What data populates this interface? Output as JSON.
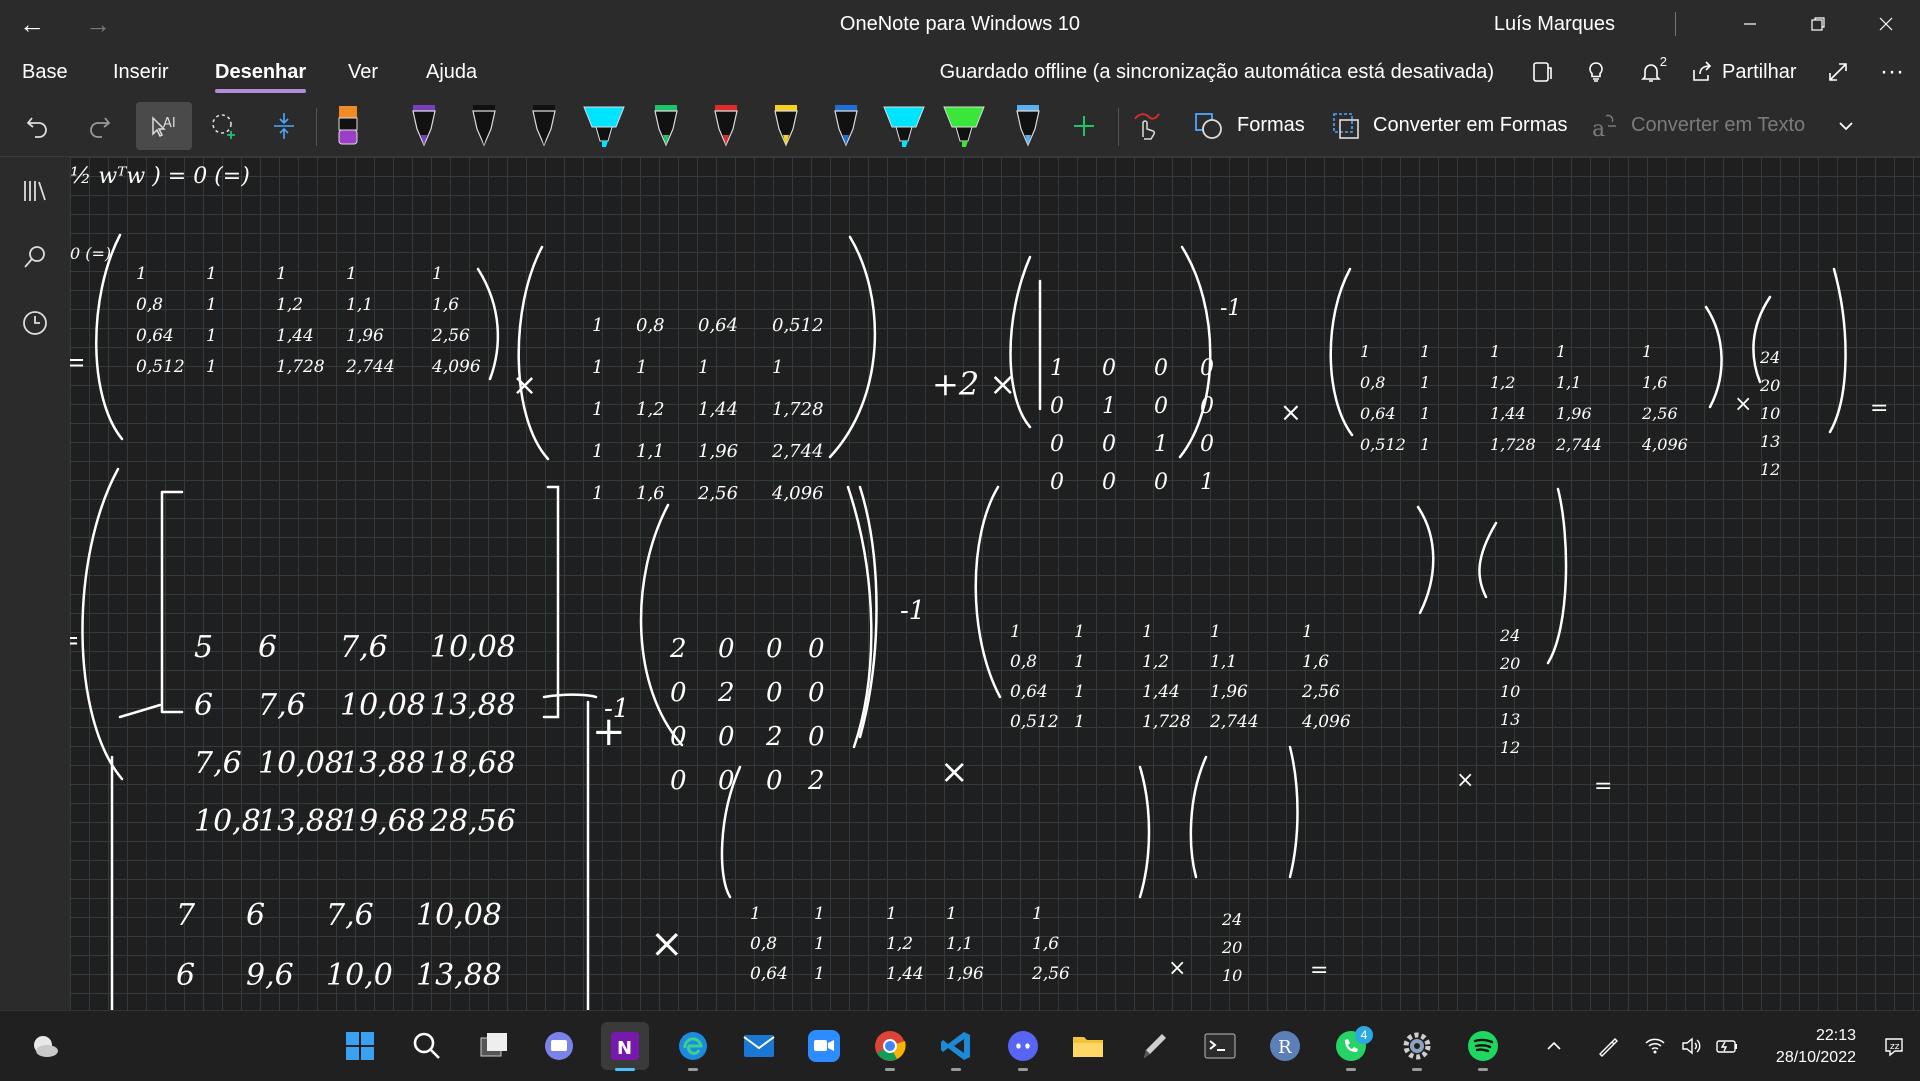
{
  "window": {
    "title": "OneNote para Windows 10",
    "user": "Luís Marques"
  },
  "ribbon": {
    "tabs": [
      "Base",
      "Inserir",
      "Desenhar",
      "Ver",
      "Ajuda"
    ],
    "active_tab": "Desenhar",
    "sync_status": "Guardado offline (a sincronização automática está desativada)",
    "share_label": "Partilhar",
    "notifications_count": "2"
  },
  "toolbar": {
    "shapes_label": "Formas",
    "convert_shapes_label": "Converter em Formas",
    "convert_text_label": "Converter em Texto",
    "accent": "#b38bd9",
    "pens": [
      {
        "name": "pen-purple",
        "color": "#7a3fbf"
      },
      {
        "name": "pen-black",
        "color": "#111111"
      },
      {
        "name": "pen-black-2",
        "color": "#111111"
      },
      {
        "name": "highlighter-cyan",
        "color": "#00e5ff"
      },
      {
        "name": "pen-green",
        "color": "#1ec46a"
      },
      {
        "name": "pen-red",
        "color": "#e02b2b"
      },
      {
        "name": "pen-yellow",
        "color": "#f6d21b"
      },
      {
        "name": "pen-blue",
        "color": "#1e6fd9"
      },
      {
        "name": "highlighter-cyan-2",
        "color": "#00e5ff"
      },
      {
        "name": "highlighter-green",
        "color": "#39e639"
      },
      {
        "name": "pen-lightblue",
        "color": "#5ab0f0"
      }
    ]
  },
  "notes": {
    "top_line": "½ wᵀw ) = 0 (=)",
    "line2": "0 (=)",
    "rows": [
      {
        "X_T": [
          [
            "1",
            "1",
            "1",
            "1",
            "1"
          ],
          [
            "0,8",
            "1",
            "1,2",
            "1,1",
            "1,6"
          ],
          [
            "0,64",
            "1",
            "1,44",
            "1,96",
            "2,56"
          ],
          [
            "0,512",
            "1",
            "1,728",
            "2,744",
            "4,096"
          ]
        ],
        "X": [
          [
            "1",
            "0,8",
            "0,64",
            "0,512"
          ],
          [
            "1",
            "1",
            "1",
            "1"
          ],
          [
            "1",
            "1,2",
            "1,44",
            "1,728"
          ],
          [
            "1",
            "1,1",
            "1,96",
            "2,744"
          ],
          [
            "1",
            "1,6",
            "2,56",
            "4,096"
          ]
        ],
        "lambda": "+2 ×",
        "I": [
          [
            "1",
            "0",
            "0",
            "0"
          ],
          [
            "0",
            "1",
            "0",
            "0"
          ],
          [
            "0",
            "0",
            "1",
            "0"
          ],
          [
            "0",
            "0",
            "0",
            "1"
          ]
        ],
        "y": [
          "24",
          "20",
          "10",
          "13",
          "12"
        ]
      },
      {
        "XtX": [
          [
            "5",
            "6",
            "7,6",
            "10,08"
          ],
          [
            "6",
            "7,6",
            "10,08",
            "13,88"
          ],
          [
            "7,6",
            "10,08",
            "13,88",
            "18,68"
          ],
          [
            "10,8",
            "13,88",
            "19,68",
            "28,56"
          ]
        ],
        "D": [
          [
            "2",
            "0",
            "0",
            "0"
          ],
          [
            "0",
            "2",
            "0",
            "0"
          ],
          [
            "0",
            "0",
            "2",
            "0"
          ],
          [
            "0",
            "0",
            "0",
            "2"
          ]
        ]
      },
      {
        "M": [
          [
            "7",
            "6",
            "7,6",
            "10,08"
          ],
          [
            "6",
            "9,6",
            "10,0",
            "13,88"
          ]
        ]
      }
    ],
    "inv": "-1",
    "times": "×",
    "plus": "+",
    "eq": "="
  },
  "taskbar": {
    "apps": [
      "weather",
      "start",
      "search",
      "task-view",
      "teams-chat",
      "onenote",
      "edge",
      "mail",
      "zoom",
      "chrome",
      "vscode",
      "discord",
      "file-explorer",
      "pen-app",
      "terminal",
      "r-app",
      "whatsapp",
      "settings",
      "spotify"
    ],
    "whatsapp_badge": "4",
    "time": "22:13",
    "date": "28/10/2022"
  }
}
